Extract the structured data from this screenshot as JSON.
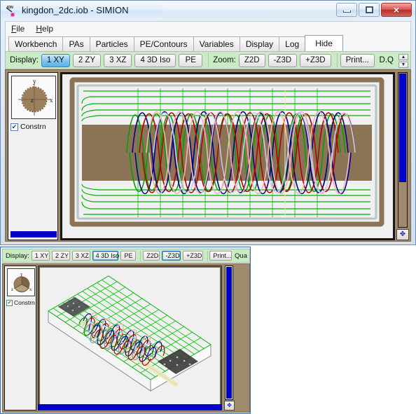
{
  "window": {
    "title": "kingdon_2dc.iob - SIMION",
    "app_icon": "simion-ion-icon",
    "controls": {
      "minimize": "minimize-icon",
      "maximize": "maximize-icon",
      "close": "×"
    }
  },
  "menu": {
    "items": [
      {
        "label": "File",
        "accel": "F"
      },
      {
        "label": "Help",
        "accel": "H"
      }
    ]
  },
  "tabs": [
    {
      "label": "Workbench",
      "active": false
    },
    {
      "label": "PAs",
      "active": false
    },
    {
      "label": "Particles",
      "active": false
    },
    {
      "label": "PE/Contours",
      "active": false
    },
    {
      "label": "Variables",
      "active": false
    },
    {
      "label": "Display",
      "active": false
    },
    {
      "label": "Log",
      "active": false
    },
    {
      "label": "Hide",
      "active": true
    }
  ],
  "toolbar": {
    "display_label": "Display:",
    "display_buttons": [
      {
        "label": "1 XY",
        "selected": true
      },
      {
        "label": "2 ZY",
        "selected": false
      },
      {
        "label": "3 XZ",
        "selected": false
      },
      {
        "label": "4 3D Iso",
        "selected": false
      },
      {
        "label": "PE",
        "selected": false
      }
    ],
    "zoom_label": "Zoom:",
    "zoom_buttons": [
      {
        "label": "Z2D"
      },
      {
        "label": "-Z3D"
      },
      {
        "label": "+Z3D"
      }
    ],
    "print_label": "Print...",
    "overflow_label": "D.Q",
    "spinner_up": "▲",
    "spinner_down": "▼"
  },
  "orientation": {
    "axis_x": "x",
    "axis_y": "y",
    "axis_z": "z",
    "constrain_label": "Constrn",
    "constrain_checked": true,
    "check_glyph": "✔"
  },
  "iso_window": {
    "display_label": "Display:",
    "display_buttons": [
      {
        "label": "1 XY",
        "selected": false
      },
      {
        "label": "2 ZY",
        "selected": false
      },
      {
        "label": "3 XZ",
        "selected": false
      },
      {
        "label": "4 3D Iso",
        "selected": true
      },
      {
        "label": "PE",
        "selected": false
      }
    ],
    "zoom_buttons": [
      {
        "label": "Z2D"
      },
      {
        "label": "-Z3D",
        "selected": true
      },
      {
        "label": "+Z3D"
      }
    ],
    "print_label": "Print...",
    "overflow_label": "Qua",
    "orientation": {
      "axis_x": "x",
      "axis_y": "y",
      "axis_z": "z",
      "constrain_label": "Constrn",
      "constrain_checked": true,
      "check_glyph": "✔"
    },
    "move_icon": "✥"
  },
  "colors": {
    "toolbar_green": "#c9ecc4",
    "workspace_brown": "#a08a6e",
    "electrode_brown": "#8b7355",
    "contour_green": "#00b400",
    "trajectory_blue": "#00008c",
    "trajectory_red": "#b40000",
    "trajectory_pink": "#f0b4b4",
    "scrollbar_blue": "#0000c8",
    "selected_tab_blue": "#58b0e8"
  },
  "viewport": {
    "move_icon": "✥",
    "scene_description": "kingdon ion trap 2d cross-section with ion trajectories over equipotential contours"
  }
}
